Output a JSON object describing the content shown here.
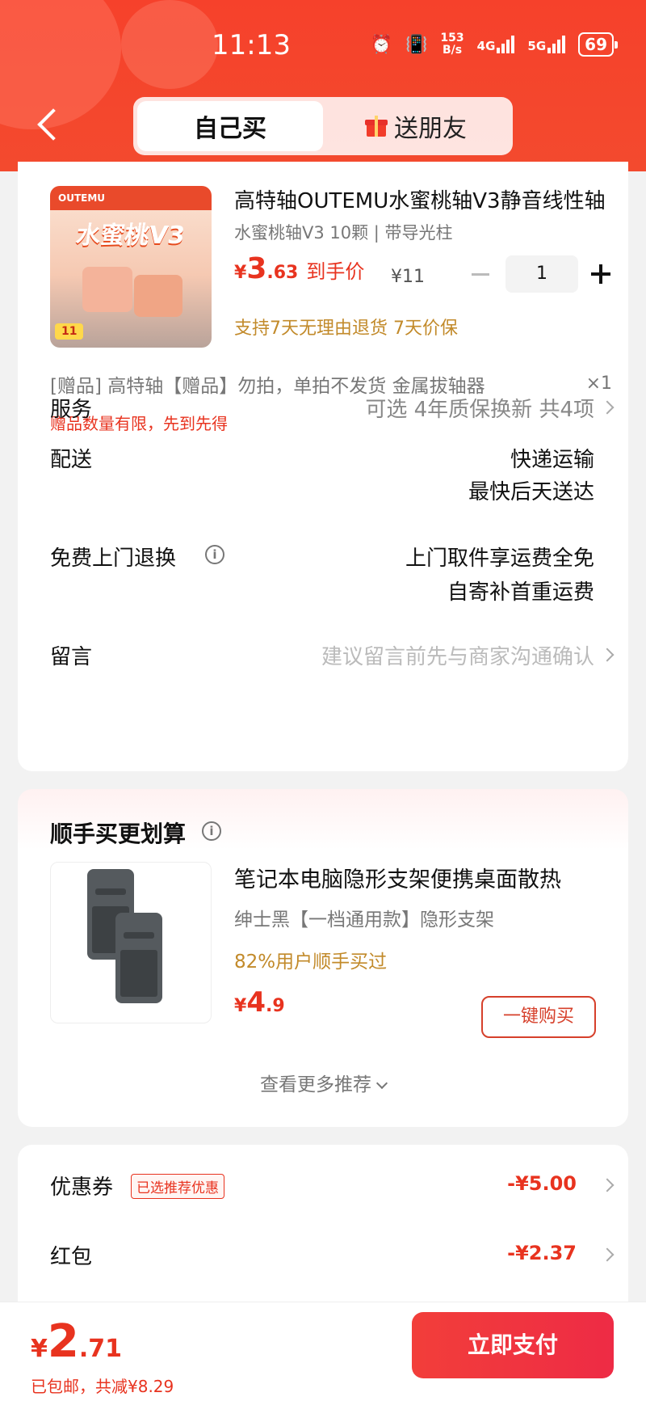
{
  "status": {
    "time": "11:13",
    "net_speed_value": "153",
    "net_speed_unit": "B/s",
    "signal1": "4G",
    "signal2": "5G",
    "battery": "69"
  },
  "tabs": {
    "self": "自己买",
    "gift": "送朋友"
  },
  "product": {
    "title": "高特轴OUTEMU水蜜桃轴V3静音线性轴",
    "spec": "水蜜桃轴V3 10颗 | 带导光柱",
    "price_yen": "¥",
    "price_int": "3",
    "price_dec": ".63",
    "price_label": "到手价",
    "original_price": "¥11",
    "quantity": "1",
    "policy": "支持7天无理由退货  7天价保",
    "image_banner": "OUTEMU",
    "image_text": "水蜜桃V3",
    "image_tag": "11"
  },
  "gift": {
    "text": "[赠品]  高特轴【赠品】勿拍，单拍不发货 金属拔轴器",
    "qty": "×1",
    "note": "赠品数量有限，先到先得"
  },
  "rows": {
    "service_label": "服务",
    "service_value": "可选 4年质保换新 共4项",
    "delivery_label": "配送",
    "delivery_value1": "快递运输",
    "delivery_value2": "最快后天送达",
    "return_label": "免费上门退换",
    "return_value1": "上门取件享运费全免",
    "return_value2": "自寄补首重运费",
    "message_label": "留言",
    "message_placeholder": "建议留言前先与商家沟通确认"
  },
  "recommend": {
    "title": "顺手买更划算",
    "name": "笔记本电脑隐形支架便携桌面散热",
    "spec": "绅士黑【一档通用款】隐形支架",
    "bought": "82%用户顺手买过",
    "price_yen": "¥",
    "price_int": "4",
    "price_dec": ".9",
    "buy_label": "一键购买",
    "more_label": "查看更多推荐"
  },
  "discounts": {
    "coupon_label": "优惠券",
    "coupon_badge": "已选推荐优惠",
    "coupon_value": "-¥5.00",
    "redpacket_label": "红包",
    "redpacket_value": "-¥2.37"
  },
  "bottom": {
    "total_yen": "¥",
    "total_int": "2",
    "total_dec": ".71",
    "note": "已包邮，共减¥8.29",
    "pay_label": "立即支付"
  },
  "colors": {
    "header_red": "#f6412b",
    "price_red": "#e8331f",
    "gold": "#c28a2a"
  }
}
